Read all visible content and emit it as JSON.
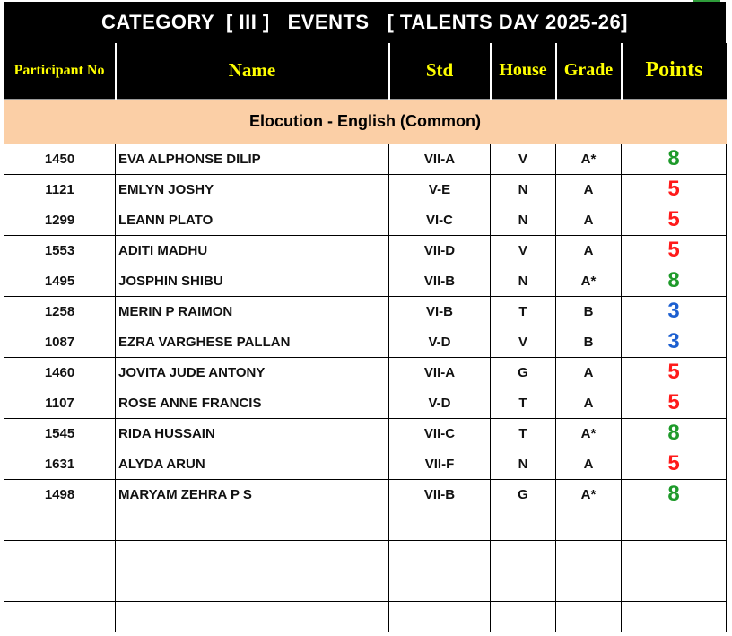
{
  "title": "CATEGORY  [ III ]   EVENTS   [ TALENTS DAY 2025-26]",
  "headers": {
    "participant_no": "Participant No",
    "name": "Name",
    "std": "Std",
    "house": "House",
    "grade": "Grade",
    "points": "Points"
  },
  "section": "Elocution - English (Common)",
  "point_colors": {
    "8": "#1e9a2a",
    "5": "#ff1a1a",
    "3": "#1c5fd0"
  },
  "rows": [
    {
      "no": "1450",
      "name": "EVA ALPHONSE DILIP",
      "std": "VII-A",
      "house": "V",
      "grade": "A*",
      "points": "8"
    },
    {
      "no": "1121",
      "name": "EMLYN JOSHY",
      "std": "V-E",
      "house": "N",
      "grade": "A",
      "points": "5"
    },
    {
      "no": "1299",
      "name": "LEANN PLATO",
      "std": "VI-C",
      "house": "N",
      "grade": "A",
      "points": "5"
    },
    {
      "no": "1553",
      "name": "ADITI MADHU",
      "std": "VII-D",
      "house": "V",
      "grade": "A",
      "points": "5"
    },
    {
      "no": "1495",
      "name": "JOSPHIN SHIBU",
      "std": "VII-B",
      "house": "N",
      "grade": "A*",
      "points": "8"
    },
    {
      "no": "1258",
      "name": "MERIN P RAIMON",
      "std": "VI-B",
      "house": "T",
      "grade": "B",
      "points": "3"
    },
    {
      "no": "1087",
      "name": "EZRA VARGHESE PALLAN",
      "std": "V-D",
      "house": "V",
      "grade": "B",
      "points": "3"
    },
    {
      "no": "1460",
      "name": "JOVITA JUDE ANTONY",
      "std": "VII-A",
      "house": "G",
      "grade": "A",
      "points": "5"
    },
    {
      "no": "1107",
      "name": "ROSE ANNE FRANCIS",
      "std": "V-D",
      "house": "T",
      "grade": "A",
      "points": "5"
    },
    {
      "no": "1545",
      "name": "RIDA HUSSAIN",
      "std": "VII-C",
      "house": "T",
      "grade": "A*",
      "points": "8"
    },
    {
      "no": "1631",
      "name": "ALYDA ARUN",
      "std": "VII-F",
      "house": "N",
      "grade": "A",
      "points": "5"
    },
    {
      "no": "1498",
      "name": "MARYAM ZEHRA P S",
      "std": "VII-B",
      "house": "G",
      "grade": "A*",
      "points": "8"
    }
  ]
}
